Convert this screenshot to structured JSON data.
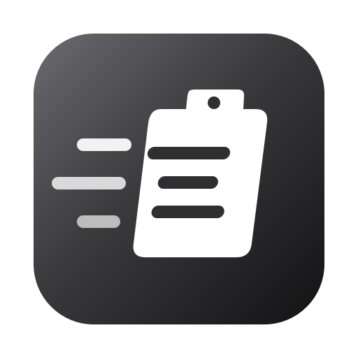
{
  "icon": {
    "name": "clipboard-icon",
    "background_gradient_colors": [
      "#6b6b70",
      "#3a3a3d",
      "#121213"
    ],
    "foreground_color": "#ffffff",
    "clipboard_line_color": "#2f2f31",
    "motion_line_colors": [
      "#f2f2f2",
      "#d9d9d9",
      "#bdbdbd"
    ]
  }
}
